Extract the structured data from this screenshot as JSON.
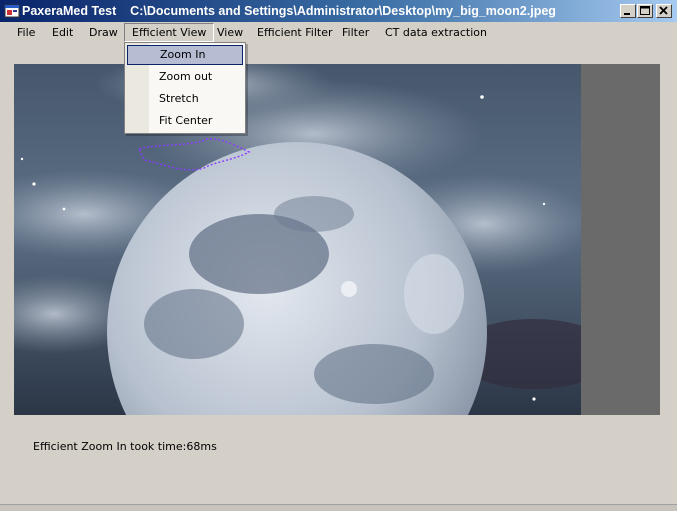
{
  "window": {
    "app_name": "PaxeraMed Test",
    "file_path": "C:\\Documents and Settings\\Administrator\\Desktop\\my_big_moon2.jpeg",
    "title_separator": "    "
  },
  "menu": [
    {
      "label": "File"
    },
    {
      "label": "Edit"
    },
    {
      "label": "Draw"
    },
    {
      "label": "Efficient View"
    },
    {
      "label": "View"
    },
    {
      "label": "Efficient Filter"
    },
    {
      "label": "Filter"
    },
    {
      "label": "CT data extraction"
    }
  ],
  "dropdown": [
    {
      "label": "Zoom In"
    },
    {
      "label": "Zoom out"
    },
    {
      "label": "Stretch"
    },
    {
      "label": "Fit Center"
    }
  ],
  "status": {
    "text": "Efficient Zoom In took time:68ms"
  },
  "colors": {
    "titlebar_start": "#0a246a",
    "titlebar_end": "#a6caf0",
    "menu_highlight": "#b6bdd2",
    "window_bg": "#d4d0c8",
    "annotation_stroke": "#8a3cff"
  }
}
